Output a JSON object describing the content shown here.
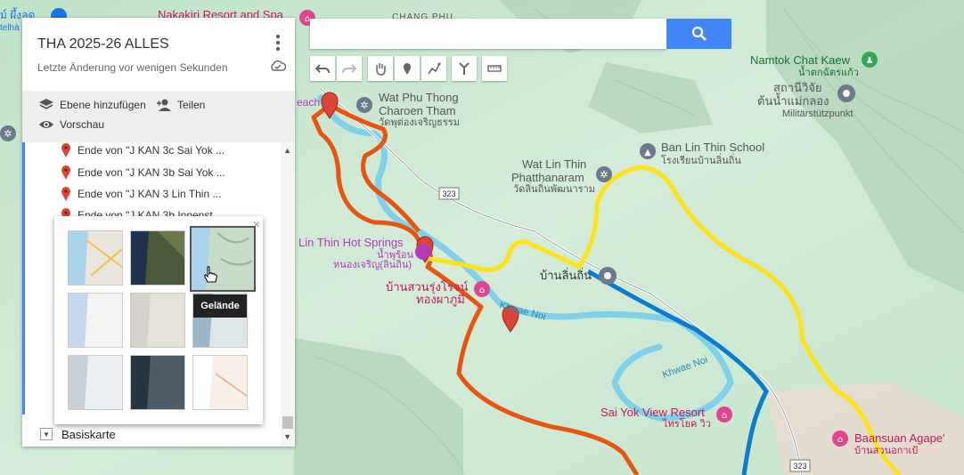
{
  "doc": {
    "title": "THA 2025-26 ALLES",
    "subtitle": "Letzte Änderung vor wenigen Sekunden"
  },
  "actions": {
    "add_layer": "Ebene hinzufügen",
    "share": "Teilen",
    "preview": "Vorschau"
  },
  "layer_items": [
    "Ende von \"J KAN 3c Sai Yok ...",
    "Ende von \"J KAN 3b Sai Yok ...",
    "Ende von \"J KAN 3 Lin Thin ...",
    "Ende von \"J KAN 3b Innenst..."
  ],
  "basemap": {
    "label": "Basiskarte",
    "tooltip": "Gelände"
  },
  "search": {
    "placeholder": ""
  },
  "map_labels": {
    "nakakiri": "Nakakiri Resort and Spa",
    "chang_phu": "CHANG PHU",
    "top_left_thai": "ม์ ผึ้งลด",
    "top_left_small": "telhà",
    "namtok_en": "Namtok Chat Kaew",
    "namtok_th": "น้ำตกฉัตรแก้ว",
    "station_th": "สถานีวิจัย",
    "station_th2": "ต้นน้ำแม่กลอง",
    "station_de": "Militärstützpunkt",
    "wat_phu_1": "Wat Phu Thong",
    "wat_phu_2": "Charoen Tham",
    "wat_phu_th": "วัดพุต่องเจริญธรรม",
    "beach": "each",
    "ban_lin_school": "Ban Lin Thin School",
    "ban_lin_school_th": "โรงเรียนบ้านลิ่นถิ่น",
    "wat_lin_1": "Wat Lin Thin",
    "wat_lin_2": "Phatthanaram",
    "wat_lin_th": "วัดลิ่นถิ่นพัฒนาราม",
    "road_323": "323",
    "hot_springs": "Lin Thin Hot Springs",
    "hot_springs_th1": "น้ำพุร้อน",
    "hot_springs_th2": "หนองเจริญ(ลิ่นถิ่น)",
    "ban_lin": "บ้านลิ่นถิ่น",
    "resort_th1": "บ้านสวนรุ่งโรจน์",
    "resort_th2": "ทองผาภูมิ",
    "khwae_noi_1": "Khwae Noi",
    "khwae_noi_2": "Khwae Noi",
    "sai_yok": "Sai Yok View Resort",
    "sai_yok_th": "ไทรโยค วิว",
    "baansuan": "Baansuan Agape'",
    "baansuan_th": "บ้านสวนอกาเป้"
  },
  "colors": {
    "route_orange": "#e8540e",
    "route_yellow": "#ffe21a",
    "route_blue": "#0a7dd0",
    "river": "#7fd0e8",
    "marker_red": "#db4437",
    "accent_blue": "#4285f4",
    "poi_purple": "#b03ab8"
  }
}
